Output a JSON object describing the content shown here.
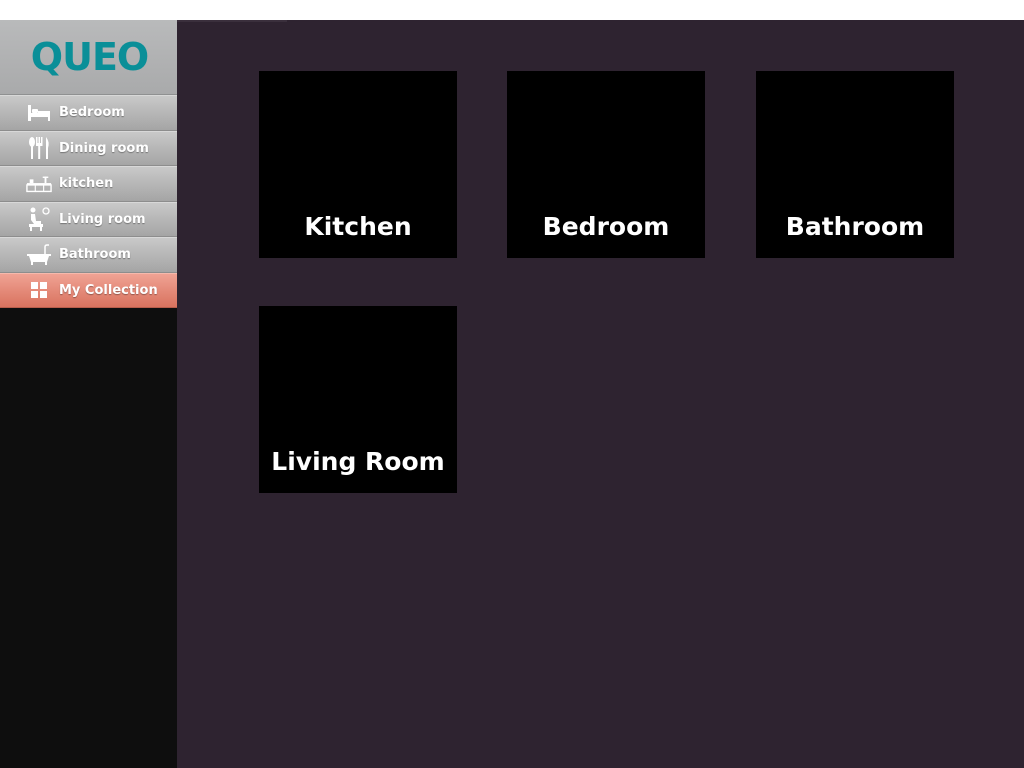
{
  "app": {
    "logo_text": "QUEO",
    "brand_color": "#0a8f98"
  },
  "sidebar": {
    "items": [
      {
        "label": "Bedroom",
        "icon": "bed-icon",
        "active": false
      },
      {
        "label": "Dining room",
        "icon": "cutlery-icon",
        "active": false
      },
      {
        "label": "kitchen",
        "icon": "kitchen-counter-icon",
        "active": false
      },
      {
        "label": "Living room",
        "icon": "armchair-person-icon",
        "active": false
      },
      {
        "label": "Bathroom",
        "icon": "bathtub-icon",
        "active": false
      },
      {
        "label": "My Collection",
        "icon": "grid-icon",
        "active": true
      }
    ],
    "active_color": "#e48a79"
  },
  "main": {
    "background": "#2e2330",
    "tiles": [
      {
        "label": "Kitchen"
      },
      {
        "label": "Bedroom"
      },
      {
        "label": "Bathroom"
      },
      {
        "label": "Living Room"
      }
    ]
  }
}
